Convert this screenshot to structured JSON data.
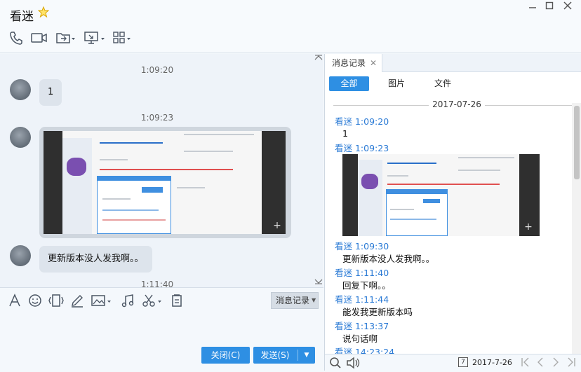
{
  "window": {
    "title": "看迷",
    "controls": [
      "minimize-icon",
      "maximize-icon",
      "close-icon"
    ]
  },
  "toolbar": {
    "icons": [
      "phone-icon",
      "video-icon",
      "transfer-file-icon",
      "remote-desktop-icon",
      "apps-icon"
    ]
  },
  "chat": {
    "messages": [
      {
        "time": "1:09:20",
        "type": "text",
        "text": "1"
      },
      {
        "time": "1:09:23",
        "type": "image"
      },
      {
        "type": "text",
        "text": "更新版本没人发我啊。。"
      },
      {
        "time": "1:11:40"
      }
    ]
  },
  "input_toolbar": {
    "icons": [
      "font-icon",
      "emoji-icon",
      "shake-icon",
      "pen-icon",
      "image-icon",
      "music-icon",
      "screenshot-icon",
      "clip-icon"
    ],
    "history_label": "消息记录"
  },
  "actions": {
    "close_label": "关闭(C)",
    "send_label": "发送(S)"
  },
  "history_panel": {
    "tab_label": "消息记录",
    "filters": [
      "全部",
      "图片",
      "文件"
    ],
    "active_filter": "全部",
    "date": "2017-07-26",
    "entries": [
      {
        "sender_time": "看迷 1:09:20",
        "text": "1"
      },
      {
        "sender_time": "看迷 1:09:23",
        "type": "image"
      },
      {
        "sender_time": "看迷 1:09:30",
        "text": "更新版本没人发我啊。。"
      },
      {
        "sender_time": "看迷 1:11:40",
        "text": "回复下啊。。"
      },
      {
        "sender_time": "看迷 1:11:44",
        "text": "能发我更新版本吗"
      },
      {
        "sender_time": "看迷 1:13:37",
        "text": "说句话啊"
      },
      {
        "sender_time": "看迷 14:23:24"
      }
    ],
    "footer_date": "2017-7-26"
  },
  "colors": {
    "accent": "#2e8fe3",
    "sender_name": "#2a7ad5",
    "bubble": "#dde4ec",
    "chat_bg": "#eef3f9"
  }
}
